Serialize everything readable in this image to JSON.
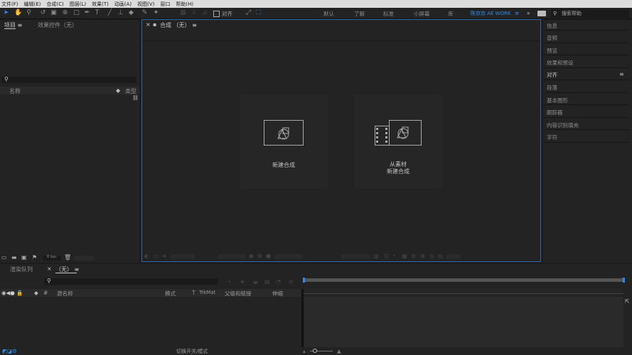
{
  "menu": [
    "文件(F)",
    "编辑(E)",
    "合成(C)",
    "图层(L)",
    "效果(T)",
    "动画(A)",
    "视图(V)",
    "窗口",
    "帮助(H)"
  ],
  "toolbar": {
    "align_label": "对齐",
    "workspaces": [
      "默认",
      "了解",
      "标准",
      "小屏幕",
      "库",
      "陈京京 AE WORK"
    ],
    "overflow": "»",
    "search_placeholder": "搜索帮助"
  },
  "project_panel": {
    "tab_project": "项目",
    "tab_effects": "效果控件（无）",
    "col_name": "名称",
    "col_type": "类型",
    "bpc": "8 bpc"
  },
  "comp_panel": {
    "tab_label": "合成 （无）",
    "new_comp_label": "新建合成",
    "from_footage_line1": "从素材",
    "from_footage_line2": "新建合成"
  },
  "right_panels": [
    "信息",
    "音频",
    "预览",
    "效果和预设",
    "对齐",
    "段落",
    "基本图形",
    "跟踪器",
    "内容识别填充",
    "字符"
  ],
  "timeline": {
    "tab_render": "渲染队列",
    "tab_comp": "（无）",
    "col_hash": "#",
    "col_source": "源名称",
    "col_mode": "模式",
    "col_t": "T",
    "col_trkmat": "TrkMat",
    "col_parent": "父级和链接",
    "col_stretch": "伸缩",
    "bottom_toggle": "切换开关/模式"
  },
  "colors": {
    "accent": "#2d8ceb",
    "panel": "#232323",
    "bg": "#1d1d1d"
  }
}
